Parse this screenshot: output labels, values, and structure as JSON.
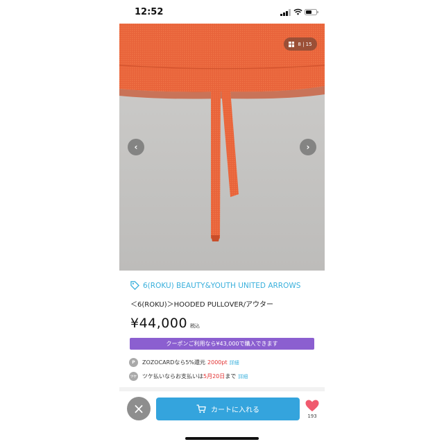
{
  "status_bar": {
    "time": "12:52"
  },
  "gallery": {
    "counter": "8 | 15",
    "prev_icon": "chevron-left-icon",
    "next_icon": "chevron-right-icon"
  },
  "product": {
    "brand": "6(ROKU) BEAUTY&YOUTH UNITED ARROWS",
    "name": "＜6(ROKU)＞HOODED PULLOVER/アウター",
    "price": "¥44,000",
    "tax_label": "税込",
    "coupon_text": "クーポンご利用なら¥43,000で購入できます"
  },
  "benefits": [
    {
      "icon_text": "P",
      "text": "ZOZOCARDなら5%還元",
      "highlight": "2000pt",
      "suffix": "",
      "link": "詳細"
    },
    {
      "icon_text": "ツケ",
      "text": "ツケ払いならお支払いは",
      "highlight": "5月20日",
      "suffix": "まで",
      "link": "詳細"
    }
  ],
  "bottom_bar": {
    "cart_label": "カートに入れる",
    "favorite_count": "193"
  },
  "colors": {
    "accent": "#34a4dd",
    "brand_link": "#3ab0dc",
    "coupon": "#8b5fd0",
    "highlight": "#e23030",
    "fabric": "#e8633a"
  }
}
